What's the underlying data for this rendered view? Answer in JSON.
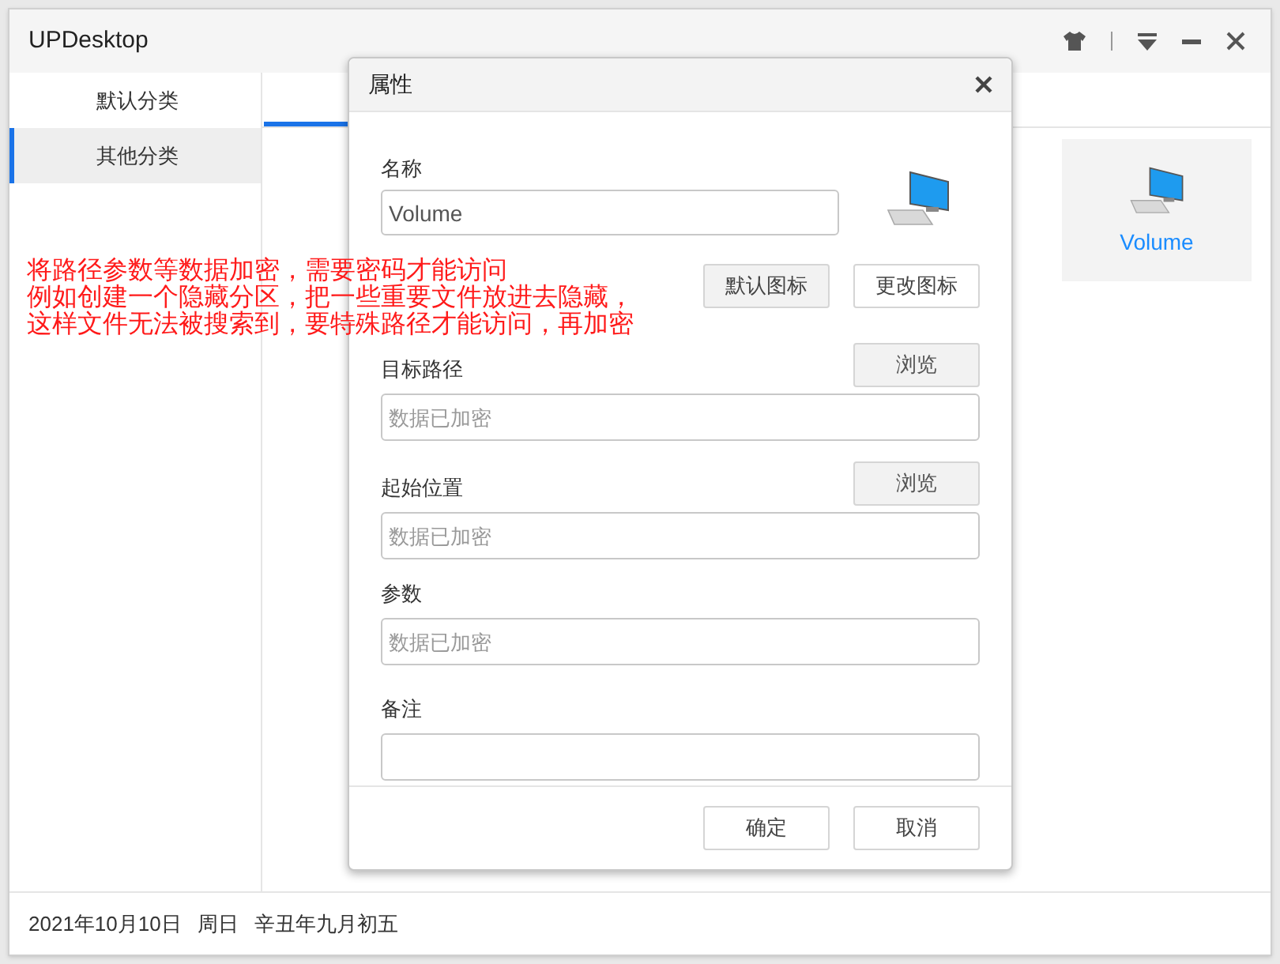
{
  "window": {
    "title": "UPDesktop"
  },
  "sidebar": {
    "items": [
      {
        "label": "默认分类",
        "selected": false
      },
      {
        "label": "其他分类",
        "selected": true
      }
    ]
  },
  "tabs": [
    {
      "selected": true
    }
  ],
  "items": [
    {
      "label": "Volume",
      "selected": true
    }
  ],
  "status_bar": {
    "date": "2021年10月10日",
    "weekday": "周日",
    "lunar": "辛丑年九月初五"
  },
  "dialog": {
    "title": "属性",
    "name_field": {
      "label": "名称",
      "value": "Volume"
    },
    "icon_buttons": [
      "默认图标",
      "更改图标"
    ],
    "fields": [
      {
        "label": "目标路径",
        "placeholder": "数据已加密",
        "browse": "浏览"
      },
      {
        "label": "起始位置",
        "placeholder": "数据已加密",
        "browse": "浏览"
      },
      {
        "label": "参数",
        "placeholder": "数据已加密"
      },
      {
        "label": "备注"
      }
    ],
    "buttons": [
      "确定",
      "取消"
    ]
  },
  "annotation": [
    "将路径参数等数据加密，需要密码才能访问",
    "例如创建一个隐藏分区，把一些重要文件放进去隐藏，",
    "这样文件无法被搜索到，要特殊路径才能访问，再加密"
  ]
}
